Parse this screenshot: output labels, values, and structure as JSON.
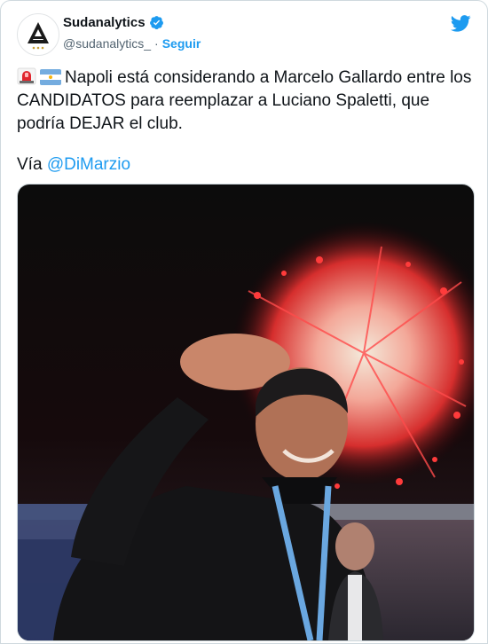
{
  "account": {
    "display_name": "Sudanalytics",
    "handle": "@sudanalytics_",
    "follow_label": "Seguir"
  },
  "tweet": {
    "text_main": "Napoli está considerando a Marcelo Gallardo entre los CANDIDATOS para reemplazar a Luciano Spaletti, que podría DEJAR el club.",
    "via_prefix": "Vía ",
    "via_mention": "@DiMarzio"
  },
  "icons": [
    "logo-avatar",
    "verified-badge-icon",
    "twitter-bird-icon",
    "siren-emoji-icon",
    "argentina-flag-icon"
  ],
  "colors": {
    "accent": "#1d9bf0",
    "text": "#0f1419",
    "secondary_text": "#536471"
  }
}
